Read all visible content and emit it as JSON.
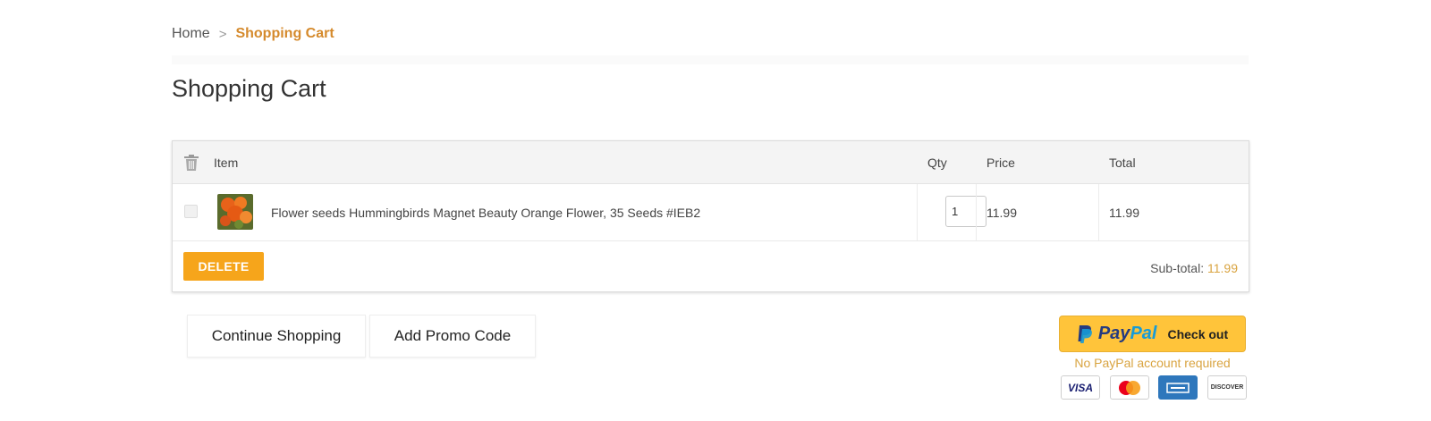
{
  "breadcrumb": {
    "home": "Home",
    "separator": ">",
    "current": "Shopping Cart"
  },
  "page_title": "Shopping Cart",
  "table": {
    "headers": {
      "item": "Item",
      "qty": "Qty",
      "price": "Price",
      "total": "Total"
    },
    "rows": [
      {
        "name": "Flower seeds Hummingbirds Magnet Beauty Orange Flower, 35 Seeds #IEB2",
        "qty": "1",
        "price": "11.99",
        "total": "11.99"
      }
    ],
    "delete_label": "DELETE",
    "subtotal_label": "Sub-total:",
    "subtotal_value": "11.99"
  },
  "actions": {
    "continue_label": "Continue Shopping",
    "promo_label": "Add Promo Code"
  },
  "paypal": {
    "brand_pay": "Pay",
    "brand_pal": "Pal",
    "checkout_label": "Check out",
    "note": "No PayPal account required"
  },
  "cards": {
    "visa": "VISA",
    "discover": "DISCOVER"
  },
  "colors": {
    "accent": "#d58a2c",
    "delete_button": "#f6a51b",
    "paypal_yellow": "#ffc43a",
    "paypal_dark_blue": "#253b80",
    "paypal_light_blue": "#179bd7"
  },
  "icons": {
    "trash": "trash-icon",
    "paypal_logo": "paypal-logo-icon",
    "product_thumb": "product-thumbnail"
  }
}
